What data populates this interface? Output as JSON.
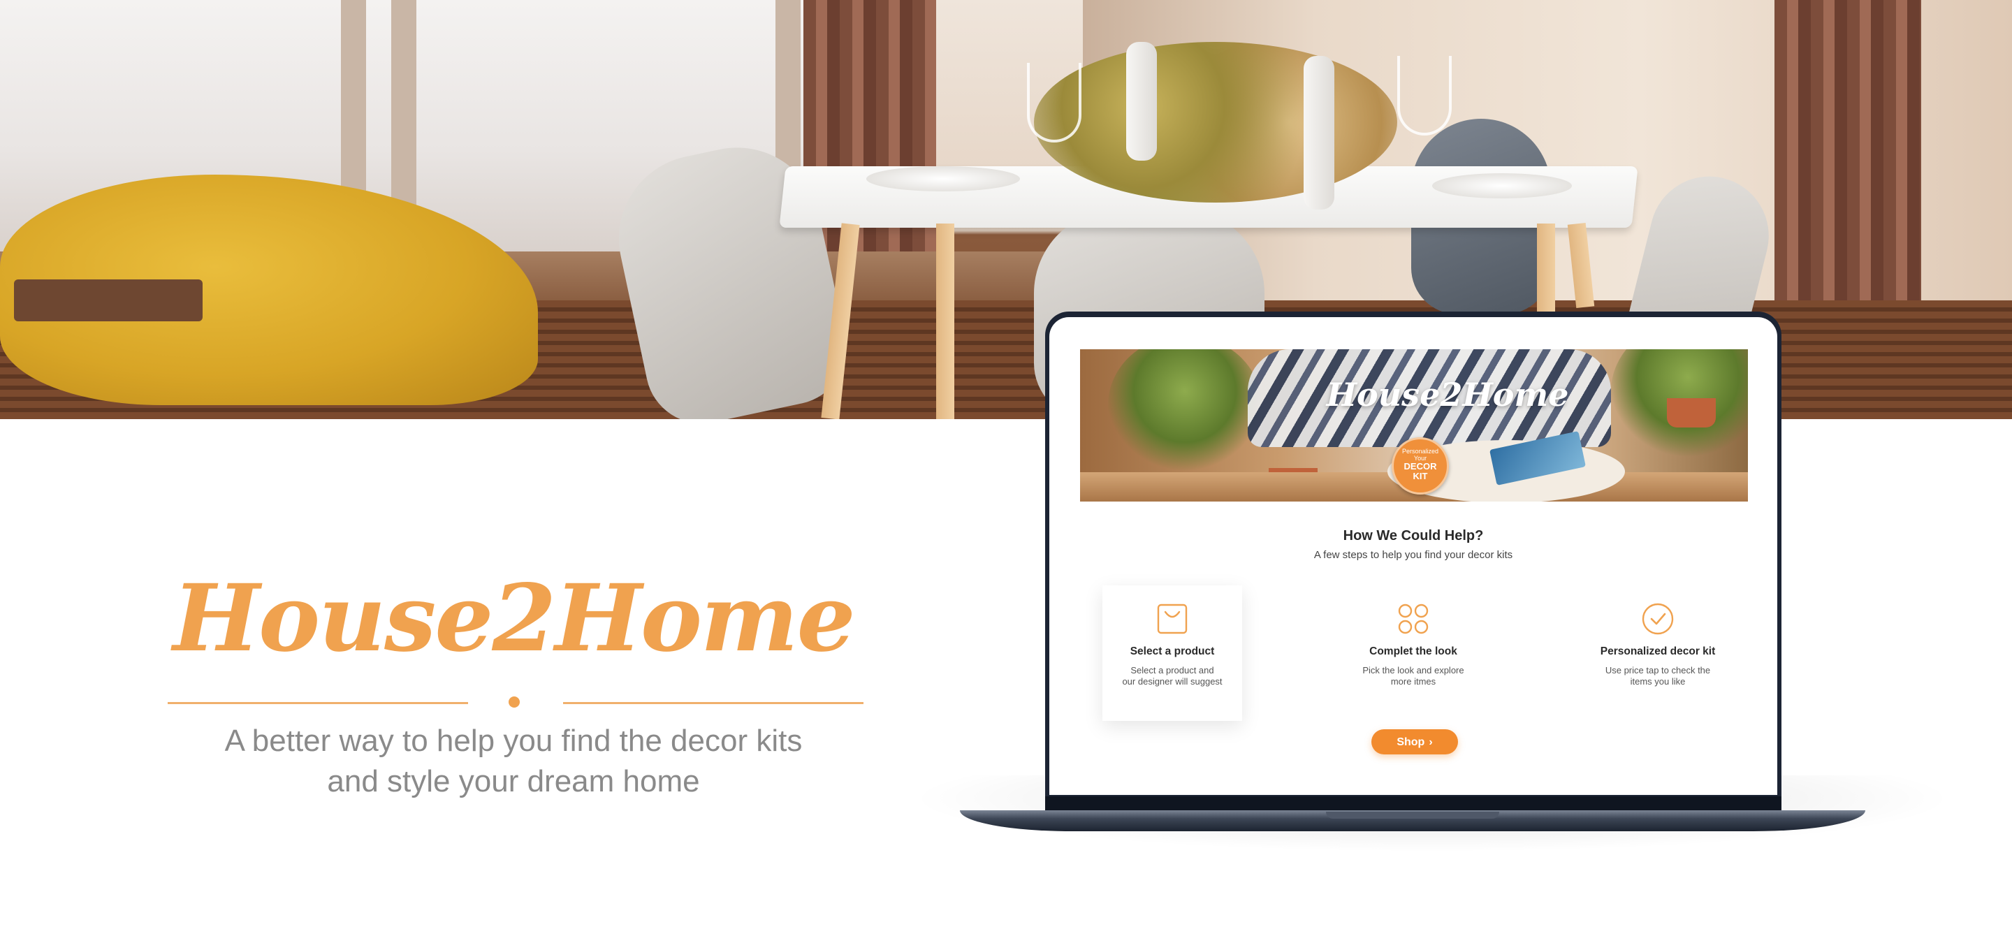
{
  "brand": {
    "name": "House2Home",
    "tagline_lines": [
      "A better way to help you find the decor kits",
      "and style your dream home"
    ],
    "accent_color": "#f0a24f"
  },
  "laptop_site": {
    "banner": {
      "brand": "House2Home",
      "badge_small_lines": [
        "Personalized",
        "Your"
      ],
      "badge_big_lines": [
        "DECOR",
        "KIT"
      ]
    },
    "help": {
      "title": "How We Could Help?",
      "subtitle": "A few steps to help you find your decor kits"
    },
    "steps": [
      {
        "icon": "shopping-bag-icon",
        "title": "Select a product",
        "desc_lines": [
          "Select a product and",
          "our designer will suggest"
        ]
      },
      {
        "icon": "grid-flower-icon",
        "title": "Complet the look",
        "desc_lines": [
          "Pick the look and explore",
          "more itmes"
        ]
      },
      {
        "icon": "check-circle-icon",
        "title": "Personalized decor kit",
        "desc_lines": [
          "Use price tap to check the",
          "items you like"
        ]
      }
    ],
    "shop_button": {
      "label": "Shop",
      "icon": "chevron-right-icon",
      "color": "#f28b2e"
    }
  }
}
